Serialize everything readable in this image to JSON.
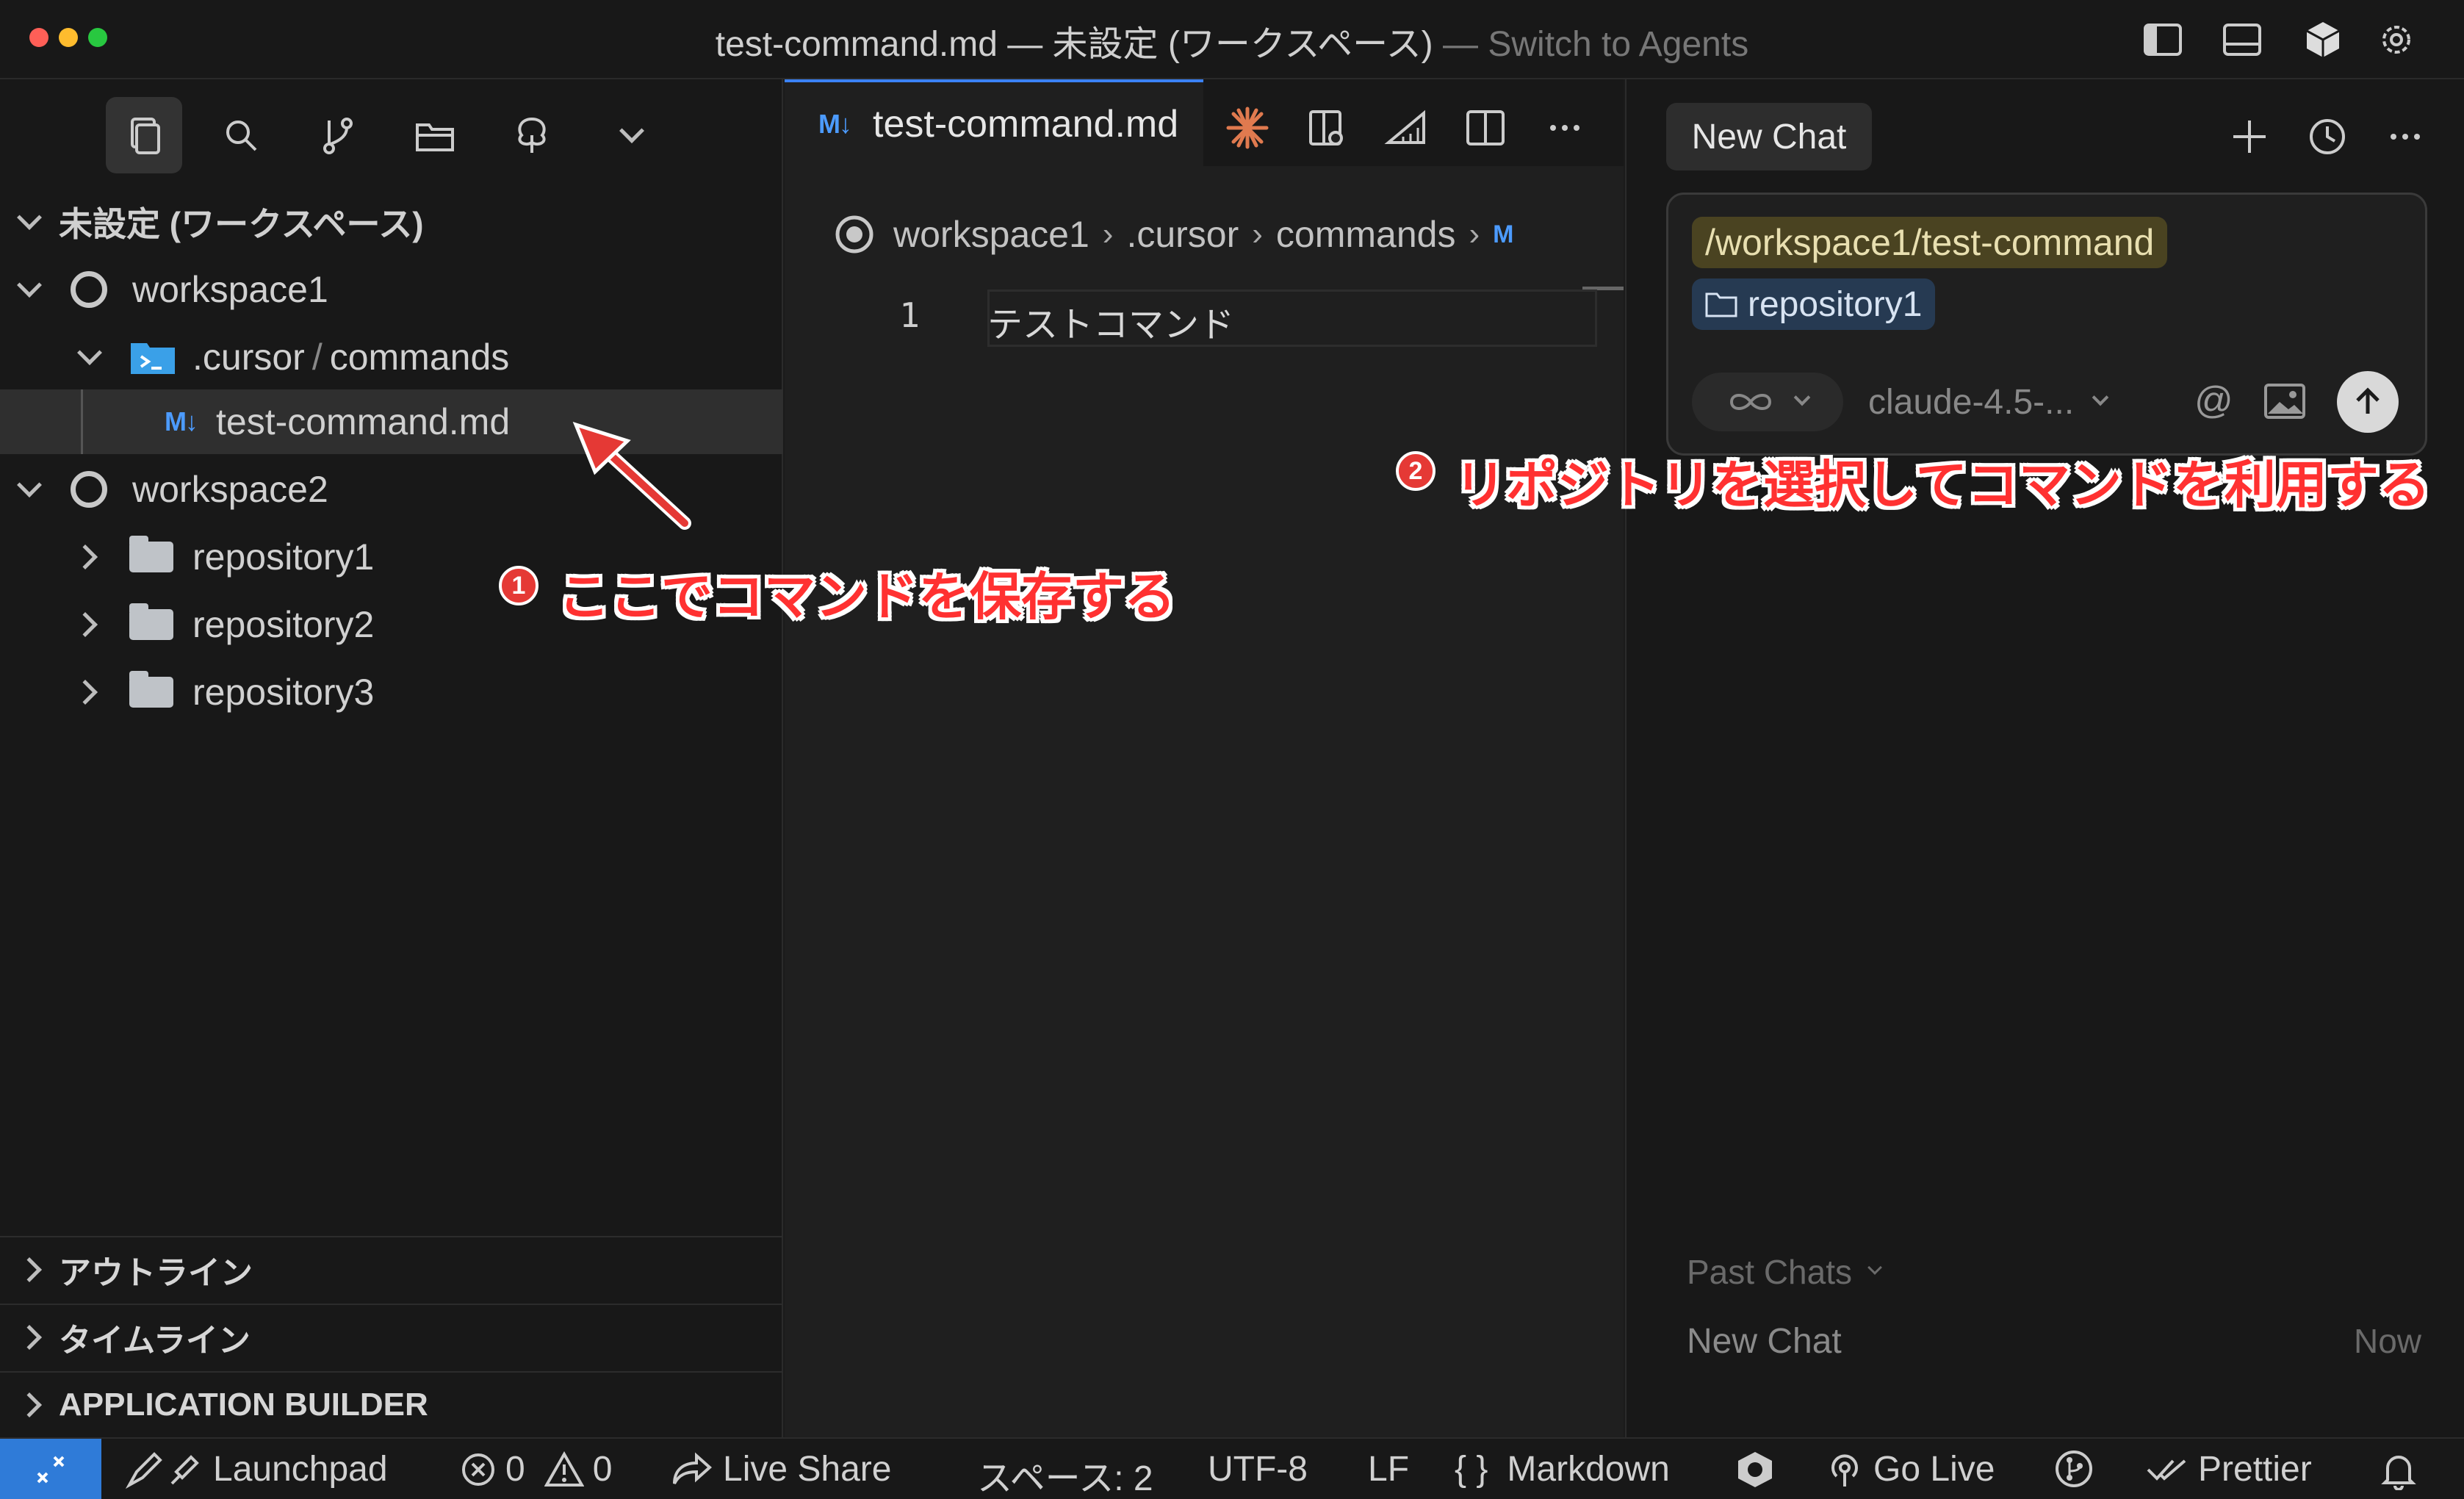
{
  "window": {
    "title_main": "test-command.md — 未設定 (ワークスペース)",
    "title_sep": " — ",
    "title_link": "Switch to Agents"
  },
  "explorer": {
    "workspace_root": "未設定 (ワークスペース)",
    "workspace1": "workspace1",
    "cursor_folder": ".cursor",
    "path_sep": "/",
    "commands_folder": "commands",
    "file_name": "test-command.md",
    "md_badge": "M↓",
    "workspace2": "workspace2",
    "repos": [
      "repository1",
      "repository2",
      "repository3"
    ]
  },
  "sections": [
    "アウトライン",
    "タイムライン",
    "APPLICATION BUILDER"
  ],
  "editor": {
    "tab_label": "test-command.md",
    "tab_badge": "M↓",
    "breadcrumb": [
      "workspace1",
      ".cursor",
      "commands"
    ],
    "breadcrumb_tail": "M",
    "line_number": "1",
    "line_text": "テストコマンド"
  },
  "chat": {
    "tab_label": "New Chat",
    "command_chip": "/workspace1/test-command",
    "repo_chip": "repository1",
    "model": "claude-4.5-...",
    "at_symbol": "@",
    "past_chats_label": "Past Chats",
    "past_items": [
      {
        "title": "New Chat",
        "time": "Now"
      }
    ]
  },
  "annotations": {
    "one_num": "1",
    "one_text": "ここでコマンドを保存する",
    "two_num": "2",
    "two_text": "リポジトリを選択してコマンドを利用する"
  },
  "status": {
    "launchpad": "Launchpad",
    "errors": "0",
    "warnings": "0",
    "live_share": "Live Share",
    "spaces": "スペース: 2",
    "encoding": "UTF-8",
    "eol": "LF",
    "lang_braces": "{ }",
    "language": "Markdown",
    "go_live": "Go Live",
    "prettier": "Prettier"
  },
  "colors": {
    "accent": "#3b82f6",
    "annotation_red": "#ff3131",
    "cmd_chip_bg": "#4a4321",
    "repo_chip_bg": "#263a52",
    "remote_button": "#2f7bd8"
  }
}
